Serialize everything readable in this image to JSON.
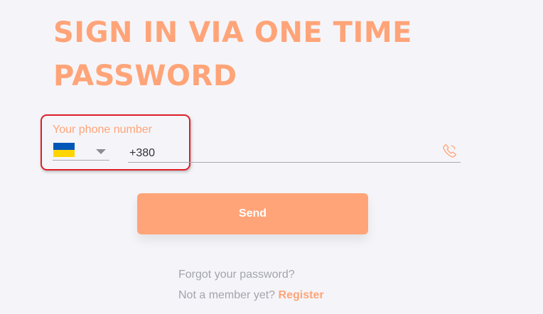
{
  "form": {
    "title": "SIGN IN VIA ONE TIME PASSWORD",
    "phone_label": "Your phone number",
    "country_flag": "ukraine-flag",
    "phone_value": "+380",
    "phone_icon": "phone-icon",
    "send_label": "Send"
  },
  "footer": {
    "forgot_password": "Forgot your password?",
    "not_member": "Not a member yet?",
    "register": "Register"
  },
  "colors": {
    "accent": "#ffa478",
    "highlight_border": "#dd1f26",
    "background": "#f5f5f9",
    "muted_text": "#a3a3ad"
  }
}
